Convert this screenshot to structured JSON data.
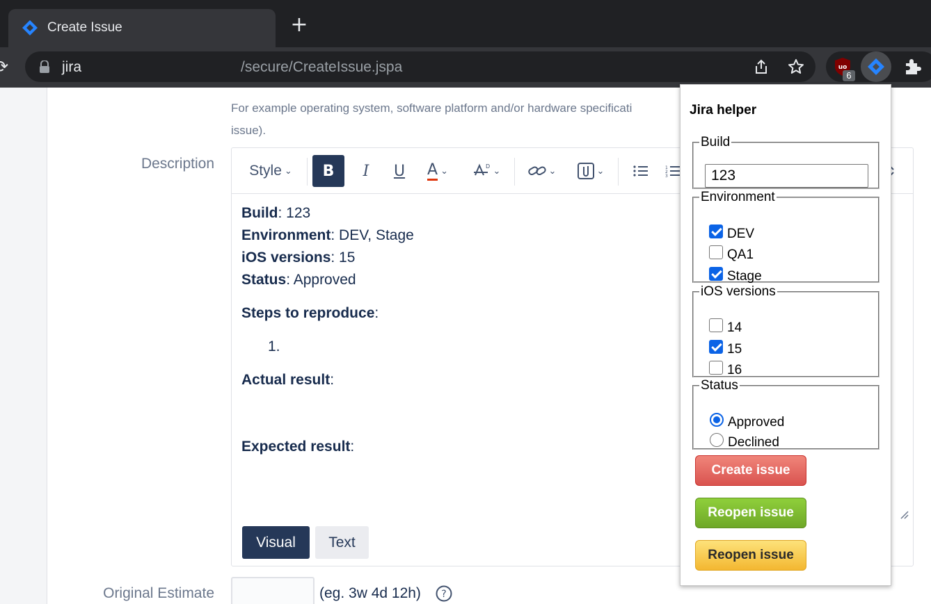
{
  "browser": {
    "tab_title": "Create Issue",
    "new_tab_symbol": "+",
    "url_host": "jira",
    "url_path": "/secure/CreateIssue.jspa",
    "extension_badge": "6"
  },
  "form": {
    "environment_help": "For example operating system, software platform and/or hardware specificati",
    "environment_help_line2": "issue).",
    "description_label": "Description",
    "toolbar": {
      "style_label": "Style",
      "bold": "B",
      "italic": "I",
      "underline": "U",
      "text_color": "A"
    },
    "description_body": {
      "build_label": "Build",
      "build_value": ": 123",
      "environment_label": "Environment",
      "environment_value": ": DEV, Stage",
      "ios_label": "iOS versions",
      "ios_value": ": 15",
      "status_label": "Status",
      "status_value": ": Approved",
      "steps_label": "Steps to reproduce",
      "steps_suffix": ":",
      "step_item": "1.",
      "actual_label": "Actual result",
      "actual_suffix": ":",
      "expected_label": "Expected result",
      "expected_suffix": ":"
    },
    "mode_visual": "Visual",
    "mode_text": "Text",
    "estimate_label": "Original Estimate",
    "estimate_hint": "(eg. 3w 4d 12h)"
  },
  "popup": {
    "title": "Jira helper",
    "build": {
      "legend": "Build",
      "value": "123"
    },
    "environment": {
      "legend": "Environment",
      "options": [
        {
          "label": "DEV",
          "checked": true
        },
        {
          "label": "QA1",
          "checked": false
        },
        {
          "label": "Stage",
          "checked": true
        }
      ]
    },
    "ios_versions": {
      "legend": "iOS versions",
      "options": [
        {
          "label": "14",
          "checked": false
        },
        {
          "label": "15",
          "checked": true
        },
        {
          "label": "16",
          "checked": false
        }
      ]
    },
    "status": {
      "legend": "Status",
      "options": [
        {
          "label": "Approved",
          "selected": true
        },
        {
          "label": "Declined",
          "selected": false
        }
      ]
    },
    "buttons": {
      "create": "Create issue",
      "reopen_green": "Reopen issue",
      "reopen_yellow": "Reopen issue"
    }
  },
  "colors": {
    "jira_blue": "#2684ff",
    "toolbar_dark": "#253858",
    "checkbox_blue": "#0b63e6",
    "create_red": "#d9534f",
    "reopen_green": "#6fa828",
    "reopen_yellow": "#f3b731"
  }
}
